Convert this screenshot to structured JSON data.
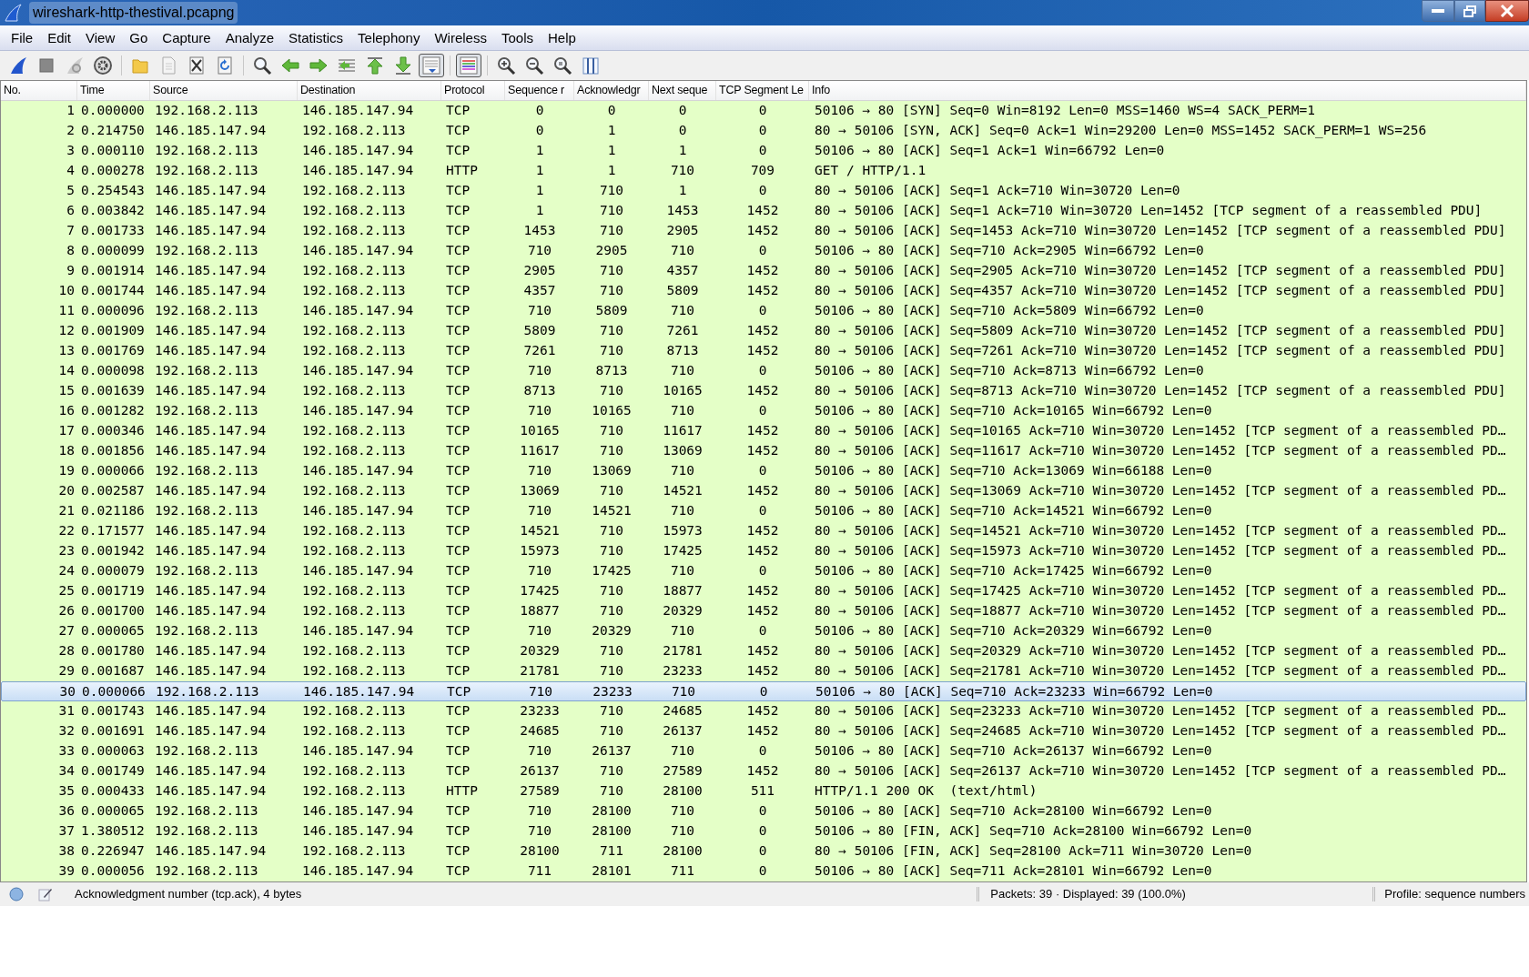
{
  "window": {
    "title": "wireshark-http-thestival.pcapng"
  },
  "menu": [
    "File",
    "Edit",
    "View",
    "Go",
    "Capture",
    "Analyze",
    "Statistics",
    "Telephony",
    "Wireless",
    "Tools",
    "Help"
  ],
  "toolbar": [
    {
      "kind": "fin",
      "pressed": false
    },
    {
      "kind": "stop",
      "pressed": false
    },
    {
      "kind": "restart",
      "pressed": false
    },
    {
      "kind": "options",
      "pressed": false
    },
    {
      "kind": "sep"
    },
    {
      "kind": "open",
      "pressed": false
    },
    {
      "kind": "file",
      "pressed": false
    },
    {
      "kind": "closefile",
      "pressed": false
    },
    {
      "kind": "reload",
      "pressed": false
    },
    {
      "kind": "sep"
    },
    {
      "kind": "find",
      "pressed": false
    },
    {
      "kind": "back",
      "pressed": false
    },
    {
      "kind": "forward",
      "pressed": false
    },
    {
      "kind": "goto",
      "pressed": false
    },
    {
      "kind": "first",
      "pressed": false
    },
    {
      "kind": "last",
      "pressed": false
    },
    {
      "kind": "autoscroll",
      "pressed": true
    },
    {
      "kind": "sep"
    },
    {
      "kind": "colorize",
      "pressed": true
    },
    {
      "kind": "sep"
    },
    {
      "kind": "zoomin",
      "pressed": false
    },
    {
      "kind": "zoomout",
      "pressed": false
    },
    {
      "kind": "zoomreset",
      "pressed": false
    },
    {
      "kind": "resize",
      "pressed": false
    }
  ],
  "table": {
    "columns": [
      "No.",
      "Time",
      "Source",
      "Destination",
      "Protocol",
      "Sequence r",
      "Acknowledgr",
      "Next seque",
      "TCP Segment Le",
      "Info"
    ],
    "rows": [
      {
        "cells": [
          "1",
          "0.000000",
          "192.168.2.113",
          "146.185.147.94",
          "TCP",
          "0",
          "0",
          "0",
          "0",
          "50106 → 80 [SYN] Seq=0 Win=8192 Len=0 MSS=1460 WS=4 SACK_PERM=1"
        ],
        "selected": false
      },
      {
        "cells": [
          "2",
          "0.214750",
          "146.185.147.94",
          "192.168.2.113",
          "TCP",
          "0",
          "1",
          "0",
          "0",
          "80 → 50106 [SYN, ACK] Seq=0 Ack=1 Win=29200 Len=0 MSS=1452 SACK_PERM=1 WS=256"
        ],
        "selected": false
      },
      {
        "cells": [
          "3",
          "0.000110",
          "192.168.2.113",
          "146.185.147.94",
          "TCP",
          "1",
          "1",
          "1",
          "0",
          "50106 → 80 [ACK] Seq=1 Ack=1 Win=66792 Len=0"
        ],
        "selected": false
      },
      {
        "cells": [
          "4",
          "0.000278",
          "192.168.2.113",
          "146.185.147.94",
          "HTTP",
          "1",
          "1",
          "710",
          "709",
          "GET / HTTP/1.1"
        ],
        "selected": false
      },
      {
        "cells": [
          "5",
          "0.254543",
          "146.185.147.94",
          "192.168.2.113",
          "TCP",
          "1",
          "710",
          "1",
          "0",
          "80 → 50106 [ACK] Seq=1 Ack=710 Win=30720 Len=0"
        ],
        "selected": false
      },
      {
        "cells": [
          "6",
          "0.003842",
          "146.185.147.94",
          "192.168.2.113",
          "TCP",
          "1",
          "710",
          "1453",
          "1452",
          "80 → 50106 [ACK] Seq=1 Ack=710 Win=30720 Len=1452 [TCP segment of a reassembled PDU]"
        ],
        "selected": false
      },
      {
        "cells": [
          "7",
          "0.001733",
          "146.185.147.94",
          "192.168.2.113",
          "TCP",
          "1453",
          "710",
          "2905",
          "1452",
          "80 → 50106 [ACK] Seq=1453 Ack=710 Win=30720 Len=1452 [TCP segment of a reassembled PDU]"
        ],
        "selected": false
      },
      {
        "cells": [
          "8",
          "0.000099",
          "192.168.2.113",
          "146.185.147.94",
          "TCP",
          "710",
          "2905",
          "710",
          "0",
          "50106 → 80 [ACK] Seq=710 Ack=2905 Win=66792 Len=0"
        ],
        "selected": false
      },
      {
        "cells": [
          "9",
          "0.001914",
          "146.185.147.94",
          "192.168.2.113",
          "TCP",
          "2905",
          "710",
          "4357",
          "1452",
          "80 → 50106 [ACK] Seq=2905 Ack=710 Win=30720 Len=1452 [TCP segment of a reassembled PDU]"
        ],
        "selected": false
      },
      {
        "cells": [
          "10",
          "0.001744",
          "146.185.147.94",
          "192.168.2.113",
          "TCP",
          "4357",
          "710",
          "5809",
          "1452",
          "80 → 50106 [ACK] Seq=4357 Ack=710 Win=30720 Len=1452 [TCP segment of a reassembled PDU]"
        ],
        "selected": false
      },
      {
        "cells": [
          "11",
          "0.000096",
          "192.168.2.113",
          "146.185.147.94",
          "TCP",
          "710",
          "5809",
          "710",
          "0",
          "50106 → 80 [ACK] Seq=710 Ack=5809 Win=66792 Len=0"
        ],
        "selected": false
      },
      {
        "cells": [
          "12",
          "0.001909",
          "146.185.147.94",
          "192.168.2.113",
          "TCP",
          "5809",
          "710",
          "7261",
          "1452",
          "80 → 50106 [ACK] Seq=5809 Ack=710 Win=30720 Len=1452 [TCP segment of a reassembled PDU]"
        ],
        "selected": false
      },
      {
        "cells": [
          "13",
          "0.001769",
          "146.185.147.94",
          "192.168.2.113",
          "TCP",
          "7261",
          "710",
          "8713",
          "1452",
          "80 → 50106 [ACK] Seq=7261 Ack=710 Win=30720 Len=1452 [TCP segment of a reassembled PDU]"
        ],
        "selected": false
      },
      {
        "cells": [
          "14",
          "0.000098",
          "192.168.2.113",
          "146.185.147.94",
          "TCP",
          "710",
          "8713",
          "710",
          "0",
          "50106 → 80 [ACK] Seq=710 Ack=8713 Win=66792 Len=0"
        ],
        "selected": false
      },
      {
        "cells": [
          "15",
          "0.001639",
          "146.185.147.94",
          "192.168.2.113",
          "TCP",
          "8713",
          "710",
          "10165",
          "1452",
          "80 → 50106 [ACK] Seq=8713 Ack=710 Win=30720 Len=1452 [TCP segment of a reassembled PDU]"
        ],
        "selected": false
      },
      {
        "cells": [
          "16",
          "0.001282",
          "192.168.2.113",
          "146.185.147.94",
          "TCP",
          "710",
          "10165",
          "710",
          "0",
          "50106 → 80 [ACK] Seq=710 Ack=10165 Win=66792 Len=0"
        ],
        "selected": false
      },
      {
        "cells": [
          "17",
          "0.000346",
          "146.185.147.94",
          "192.168.2.113",
          "TCP",
          "10165",
          "710",
          "11617",
          "1452",
          "80 → 50106 [ACK] Seq=10165 Ack=710 Win=30720 Len=1452 [TCP segment of a reassembled PD…"
        ],
        "selected": false
      },
      {
        "cells": [
          "18",
          "0.001856",
          "146.185.147.94",
          "192.168.2.113",
          "TCP",
          "11617",
          "710",
          "13069",
          "1452",
          "80 → 50106 [ACK] Seq=11617 Ack=710 Win=30720 Len=1452 [TCP segment of a reassembled PD…"
        ],
        "selected": false
      },
      {
        "cells": [
          "19",
          "0.000066",
          "192.168.2.113",
          "146.185.147.94",
          "TCP",
          "710",
          "13069",
          "710",
          "0",
          "50106 → 80 [ACK] Seq=710 Ack=13069 Win=66188 Len=0"
        ],
        "selected": false
      },
      {
        "cells": [
          "20",
          "0.002587",
          "146.185.147.94",
          "192.168.2.113",
          "TCP",
          "13069",
          "710",
          "14521",
          "1452",
          "80 → 50106 [ACK] Seq=13069 Ack=710 Win=30720 Len=1452 [TCP segment of a reassembled PD…"
        ],
        "selected": false
      },
      {
        "cells": [
          "21",
          "0.021186",
          "192.168.2.113",
          "146.185.147.94",
          "TCP",
          "710",
          "14521",
          "710",
          "0",
          "50106 → 80 [ACK] Seq=710 Ack=14521 Win=66792 Len=0"
        ],
        "selected": false
      },
      {
        "cells": [
          "22",
          "0.171577",
          "146.185.147.94",
          "192.168.2.113",
          "TCP",
          "14521",
          "710",
          "15973",
          "1452",
          "80 → 50106 [ACK] Seq=14521 Ack=710 Win=30720 Len=1452 [TCP segment of a reassembled PD…"
        ],
        "selected": false
      },
      {
        "cells": [
          "23",
          "0.001942",
          "146.185.147.94",
          "192.168.2.113",
          "TCP",
          "15973",
          "710",
          "17425",
          "1452",
          "80 → 50106 [ACK] Seq=15973 Ack=710 Win=30720 Len=1452 [TCP segment of a reassembled PD…"
        ],
        "selected": false
      },
      {
        "cells": [
          "24",
          "0.000079",
          "192.168.2.113",
          "146.185.147.94",
          "TCP",
          "710",
          "17425",
          "710",
          "0",
          "50106 → 80 [ACK] Seq=710 Ack=17425 Win=66792 Len=0"
        ],
        "selected": false
      },
      {
        "cells": [
          "25",
          "0.001719",
          "146.185.147.94",
          "192.168.2.113",
          "TCP",
          "17425",
          "710",
          "18877",
          "1452",
          "80 → 50106 [ACK] Seq=17425 Ack=710 Win=30720 Len=1452 [TCP segment of a reassembled PD…"
        ],
        "selected": false
      },
      {
        "cells": [
          "26",
          "0.001700",
          "146.185.147.94",
          "192.168.2.113",
          "TCP",
          "18877",
          "710",
          "20329",
          "1452",
          "80 → 50106 [ACK] Seq=18877 Ack=710 Win=30720 Len=1452 [TCP segment of a reassembled PD…"
        ],
        "selected": false
      },
      {
        "cells": [
          "27",
          "0.000065",
          "192.168.2.113",
          "146.185.147.94",
          "TCP",
          "710",
          "20329",
          "710",
          "0",
          "50106 → 80 [ACK] Seq=710 Ack=20329 Win=66792 Len=0"
        ],
        "selected": false
      },
      {
        "cells": [
          "28",
          "0.001780",
          "146.185.147.94",
          "192.168.2.113",
          "TCP",
          "20329",
          "710",
          "21781",
          "1452",
          "80 → 50106 [ACK] Seq=20329 Ack=710 Win=30720 Len=1452 [TCP segment of a reassembled PD…"
        ],
        "selected": false
      },
      {
        "cells": [
          "29",
          "0.001687",
          "146.185.147.94",
          "192.168.2.113",
          "TCP",
          "21781",
          "710",
          "23233",
          "1452",
          "80 → 50106 [ACK] Seq=21781 Ack=710 Win=30720 Len=1452 [TCP segment of a reassembled PD…"
        ],
        "selected": false
      },
      {
        "cells": [
          "30",
          "0.000066",
          "192.168.2.113",
          "146.185.147.94",
          "TCP",
          "710",
          "23233",
          "710",
          "0",
          "50106 → 80 [ACK] Seq=710 Ack=23233 Win=66792 Len=0"
        ],
        "selected": true
      },
      {
        "cells": [
          "31",
          "0.001743",
          "146.185.147.94",
          "192.168.2.113",
          "TCP",
          "23233",
          "710",
          "24685",
          "1452",
          "80 → 50106 [ACK] Seq=23233 Ack=710 Win=30720 Len=1452 [TCP segment of a reassembled PD…"
        ],
        "selected": false
      },
      {
        "cells": [
          "32",
          "0.001691",
          "146.185.147.94",
          "192.168.2.113",
          "TCP",
          "24685",
          "710",
          "26137",
          "1452",
          "80 → 50106 [ACK] Seq=24685 Ack=710 Win=30720 Len=1452 [TCP segment of a reassembled PD…"
        ],
        "selected": false
      },
      {
        "cells": [
          "33",
          "0.000063",
          "192.168.2.113",
          "146.185.147.94",
          "TCP",
          "710",
          "26137",
          "710",
          "0",
          "50106 → 80 [ACK] Seq=710 Ack=26137 Win=66792 Len=0"
        ],
        "selected": false
      },
      {
        "cells": [
          "34",
          "0.001749",
          "146.185.147.94",
          "192.168.2.113",
          "TCP",
          "26137",
          "710",
          "27589",
          "1452",
          "80 → 50106 [ACK] Seq=26137 Ack=710 Win=30720 Len=1452 [TCP segment of a reassembled PD…"
        ],
        "selected": false
      },
      {
        "cells": [
          "35",
          "0.000433",
          "146.185.147.94",
          "192.168.2.113",
          "HTTP",
          "27589",
          "710",
          "28100",
          "511",
          "HTTP/1.1 200 OK  (text/html)"
        ],
        "selected": false
      },
      {
        "cells": [
          "36",
          "0.000065",
          "192.168.2.113",
          "146.185.147.94",
          "TCP",
          "710",
          "28100",
          "710",
          "0",
          "50106 → 80 [ACK] Seq=710 Ack=28100 Win=66792 Len=0"
        ],
        "selected": false
      },
      {
        "cells": [
          "37",
          "1.380512",
          "192.168.2.113",
          "146.185.147.94",
          "TCP",
          "710",
          "28100",
          "710",
          "0",
          "50106 → 80 [FIN, ACK] Seq=710 Ack=28100 Win=66792 Len=0"
        ],
        "selected": false
      },
      {
        "cells": [
          "38",
          "0.226947",
          "146.185.147.94",
          "192.168.2.113",
          "TCP",
          "28100",
          "711",
          "28100",
          "0",
          "80 → 50106 [FIN, ACK] Seq=28100 Ack=711 Win=30720 Len=0"
        ],
        "selected": false
      },
      {
        "cells": [
          "39",
          "0.000056",
          "192.168.2.113",
          "146.185.147.94",
          "TCP",
          "711",
          "28101",
          "711",
          "0",
          "50106 → 80 [ACK] Seq=711 Ack=28101 Win=66792 Len=0"
        ],
        "selected": false
      }
    ]
  },
  "status_bar": {
    "field": "Acknowledgment number (tcp.ack), 4 bytes",
    "packets": "Packets: 39 · Displayed: 39 (100.0%)",
    "profile": "Profile: sequence numbers"
  }
}
